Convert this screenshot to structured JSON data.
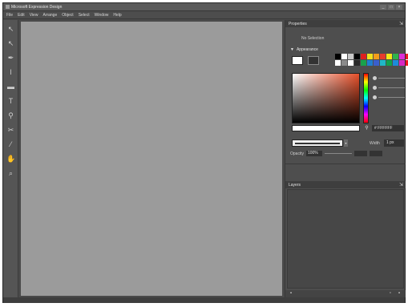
{
  "window": {
    "title": "Microsoft Expression Design"
  },
  "window_controls": [
    "_",
    "□",
    "×"
  ],
  "menu": [
    "File",
    "Edit",
    "View",
    "Arrange",
    "Object",
    "Select",
    "Window",
    "Help"
  ],
  "toolbar": {
    "tools": [
      {
        "name": "selection-tool-icon",
        "glyph": "↖"
      },
      {
        "name": "direct-selection-tool-icon",
        "glyph": "↖"
      },
      {
        "name": "pen-tool-icon",
        "glyph": "✒"
      },
      {
        "name": "brush-tool-icon",
        "glyph": "ǀ"
      },
      {
        "name": "rectangle-tool-icon",
        "glyph": "▬"
      },
      {
        "name": "text-tool-icon",
        "glyph": "T"
      },
      {
        "name": "eyedropper-tool-icon",
        "glyph": "⚲"
      },
      {
        "name": "scissors-tool-icon",
        "glyph": "✂"
      },
      {
        "name": "gradient-tool-icon",
        "glyph": "⁄"
      },
      {
        "name": "pan-hand-tool-icon",
        "glyph": "✋"
      },
      {
        "name": "zoom-tool-icon",
        "glyph": "⌕"
      }
    ]
  },
  "properties_panel": {
    "title": "Properties",
    "no_selection": "No Selection",
    "appearance_label": "Appearance",
    "swatch_colors": [
      "#000000",
      "#ffffff",
      "#c8c8c8",
      "#000000",
      "#e01f1f",
      "#f0e21c",
      "#f29d1a",
      "#e83c2c",
      "#f5e816",
      "#2fb24b",
      "#dd2dd8",
      "#ec1c24",
      "#ffffff",
      "#8a8a8a",
      "#ffffff",
      "#2a2a2a",
      "#19a24b",
      "#1f7fd0",
      "#3a5fcd",
      "#20b7c7",
      "#12a14a",
      "#1d8bd9",
      "#d628c4",
      "#f0141e"
    ],
    "hex_value": "# FFFFFF",
    "width_label": "Width",
    "width_value": "1 px",
    "opacity_label": "Opacity",
    "opacity_value": "100%"
  },
  "layers_panel": {
    "title": "Layers"
  }
}
